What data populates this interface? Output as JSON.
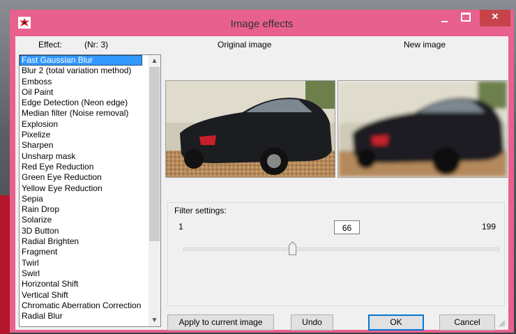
{
  "window": {
    "title": "Image effects",
    "accent_color": "#e8608d",
    "close_color": "#c7434a"
  },
  "effects": {
    "header_label": "Effect:",
    "header_count": "(Nr: 3)",
    "items": [
      "Fast Gaussian Blur",
      "Blur 2 (total variation method)",
      "Emboss",
      "Oil Paint",
      "Edge Detection (Neon edge)",
      "Median filter (Noise removal)",
      "Explosion",
      "Pixelize",
      "Sharpen",
      "Unsharp mask",
      "Red Eye Reduction",
      "Green Eye Reduction",
      "Yellow Eye Reduction",
      "Sepia",
      "Rain Drop",
      "Solarize",
      "3D Button",
      "Radial Brighten",
      "Fragment",
      "Twirl",
      "Swirl",
      "Horizontal Shift",
      "Vertical Shift",
      "Chromatic Aberration Correction",
      "Radial Blur"
    ],
    "selected_index": 0
  },
  "preview": {
    "original_label": "Original image",
    "new_label": "New image"
  },
  "filter": {
    "label": "Filter settings:",
    "min": "1",
    "max": "199",
    "value": "66"
  },
  "buttons": {
    "apply": "Apply to current image",
    "undo": "Undo",
    "ok": "OK",
    "cancel": "Cancel"
  }
}
